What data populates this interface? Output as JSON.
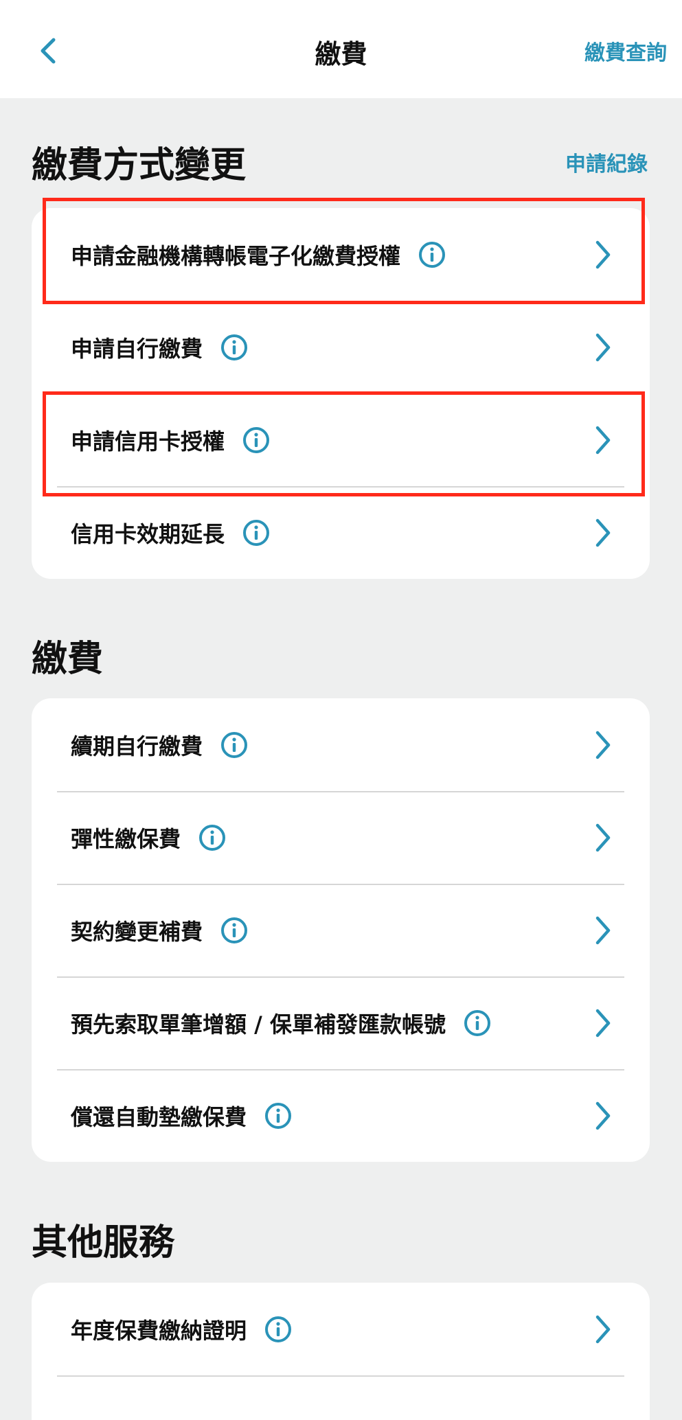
{
  "header": {
    "title": "繳費",
    "action_label": "繳費查詢",
    "back_icon": "chevron-left-icon"
  },
  "colors": {
    "accent": "#2a93b8",
    "background": "#eeefef",
    "card": "#ffffff",
    "highlight": "#ff2a1a"
  },
  "sections": [
    {
      "title": "繳費方式變更",
      "link": "申請紀錄",
      "items": [
        {
          "label": "申請金融機構轉帳電子化繳費授權",
          "highlighted": true
        },
        {
          "label": "申請自行繳費",
          "highlighted": false
        },
        {
          "label": "申請信用卡授權",
          "highlighted": true
        },
        {
          "label": "信用卡效期延長",
          "highlighted": false
        }
      ]
    },
    {
      "title": "繳費",
      "items": [
        {
          "label": "續期自行繳費"
        },
        {
          "label": "彈性繳保費"
        },
        {
          "label": "契約變更補費"
        },
        {
          "label": "預先索取單筆增額 / 保單補發匯款帳號"
        },
        {
          "label": "償還自動墊繳保費"
        }
      ]
    },
    {
      "title": "其他服務",
      "items": [
        {
          "label": "年度保費繳納證明"
        }
      ]
    }
  ]
}
